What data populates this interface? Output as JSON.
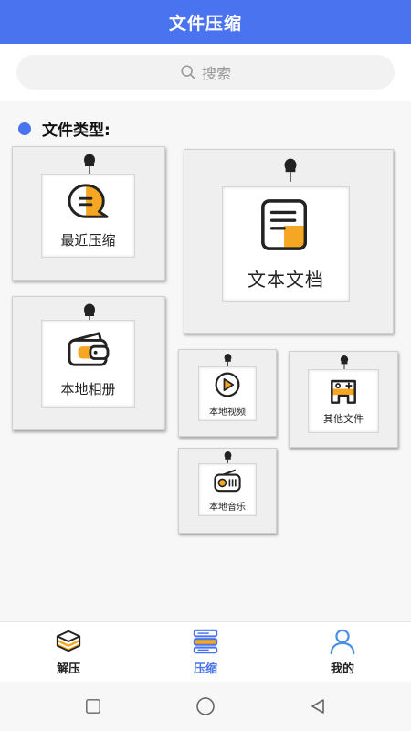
{
  "header": {
    "title": "文件压缩"
  },
  "search": {
    "placeholder": "搜索"
  },
  "section": {
    "title": "文件类型:"
  },
  "cards": {
    "recent": "最近压缩",
    "docs": "文本文档",
    "album": "本地相册",
    "video": "本地视频",
    "other": "其他文件",
    "music": "本地音乐"
  },
  "nav": {
    "items": [
      {
        "label": "解压",
        "icon": "layers-icon"
      },
      {
        "label": "压缩",
        "icon": "compress-list-icon"
      },
      {
        "label": "我的",
        "icon": "person-icon"
      }
    ]
  },
  "colors": {
    "primary": "#4a73f0",
    "accent_orange": "#f5a623"
  }
}
